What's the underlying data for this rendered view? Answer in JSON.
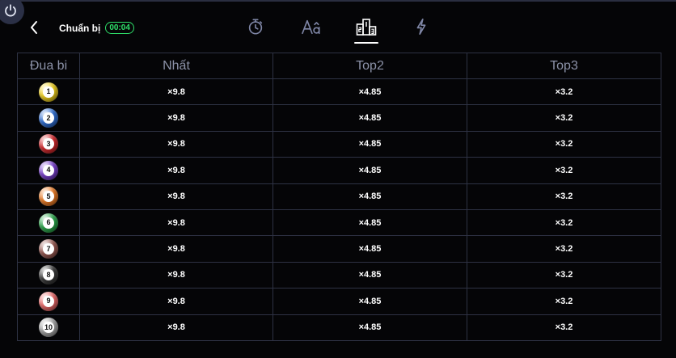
{
  "header": {
    "status_label": "Chuẩn bị",
    "timer": "00:04",
    "tabs": [
      {
        "icon": "stopwatch-icon"
      },
      {
        "icon": "letter-a-icon"
      },
      {
        "icon": "podium-icon",
        "active": true
      },
      {
        "icon": "lightning-icon"
      }
    ]
  },
  "table": {
    "columns": [
      "Đua bi",
      "Nhất",
      "Top2",
      "Top3"
    ],
    "rows": [
      {
        "ball": "1",
        "color": "#f2d21c",
        "first": "×9.8",
        "top2": "×4.85",
        "top3": "×3.2"
      },
      {
        "ball": "2",
        "color": "#2f6fd6",
        "first": "×9.8",
        "top2": "×4.85",
        "top3": "×3.2"
      },
      {
        "ball": "3",
        "color": "#d7282c",
        "first": "×9.8",
        "top2": "×4.85",
        "top3": "×3.2"
      },
      {
        "ball": "4",
        "color": "#7a3fd0",
        "first": "×9.8",
        "top2": "×4.85",
        "top3": "×3.2"
      },
      {
        "ball": "5",
        "color": "#f07d25",
        "first": "×9.8",
        "top2": "×4.85",
        "top3": "×3.2"
      },
      {
        "ball": "6",
        "color": "#2aa84a",
        "first": "×9.8",
        "top2": "×4.85",
        "top3": "×3.2"
      },
      {
        "ball": "7",
        "color": "#9a5a52",
        "first": "×9.8",
        "top2": "×4.85",
        "top3": "×3.2"
      },
      {
        "ball": "8",
        "color": "#3a3a3a",
        "first": "×9.8",
        "top2": "×4.85",
        "top3": "×3.2"
      },
      {
        "ball": "9",
        "color": "#ee6a6a",
        "first": "×9.8",
        "top2": "×4.85",
        "top3": "×3.2"
      },
      {
        "ball": "10",
        "color": "#a8a8a8",
        "first": "×9.8",
        "top2": "×4.85",
        "top3": "×3.2"
      }
    ]
  }
}
